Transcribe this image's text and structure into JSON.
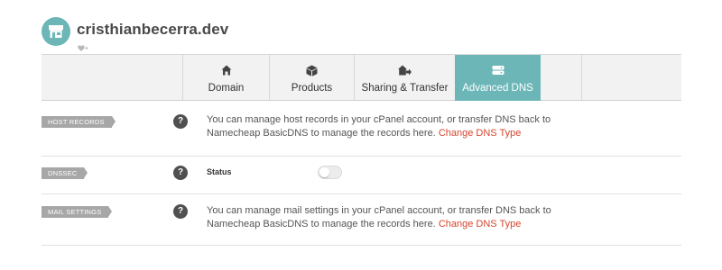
{
  "domain": {
    "name": "cristhianbecerra.dev"
  },
  "tabs": [
    {
      "label": "Domain",
      "icon": "home-icon",
      "active": false
    },
    {
      "label": "Products",
      "icon": "box-icon",
      "active": false
    },
    {
      "label": "Sharing & Transfer",
      "icon": "share-arrow-icon",
      "active": false
    },
    {
      "label": "Advanced DNS",
      "icon": "server-icon",
      "active": true
    }
  ],
  "sections": {
    "host_records": {
      "tag": "HOST RECORDS",
      "help": "?",
      "text_line1": "You can manage host records in your cPanel account, or transfer DNS back to",
      "text_line2": "Namecheap BasicDNS to manage the records here.",
      "link": "Change DNS Type"
    },
    "dnssec": {
      "tag": "DNSSEC",
      "help": "?",
      "status_label": "Status",
      "toggle_on": false
    },
    "mail_settings": {
      "tag": "MAIL SETTINGS",
      "help": "?",
      "text_line1": "You can manage mail settings in your cPanel account, or transfer DNS back to",
      "text_line2": "Namecheap BasicDNS to manage the records here.",
      "link": "Change DNS Type"
    }
  },
  "colors": {
    "accent": "#6cb6b8",
    "link": "#d6452c",
    "tag": "#a7a7a7",
    "help": "#505050"
  }
}
